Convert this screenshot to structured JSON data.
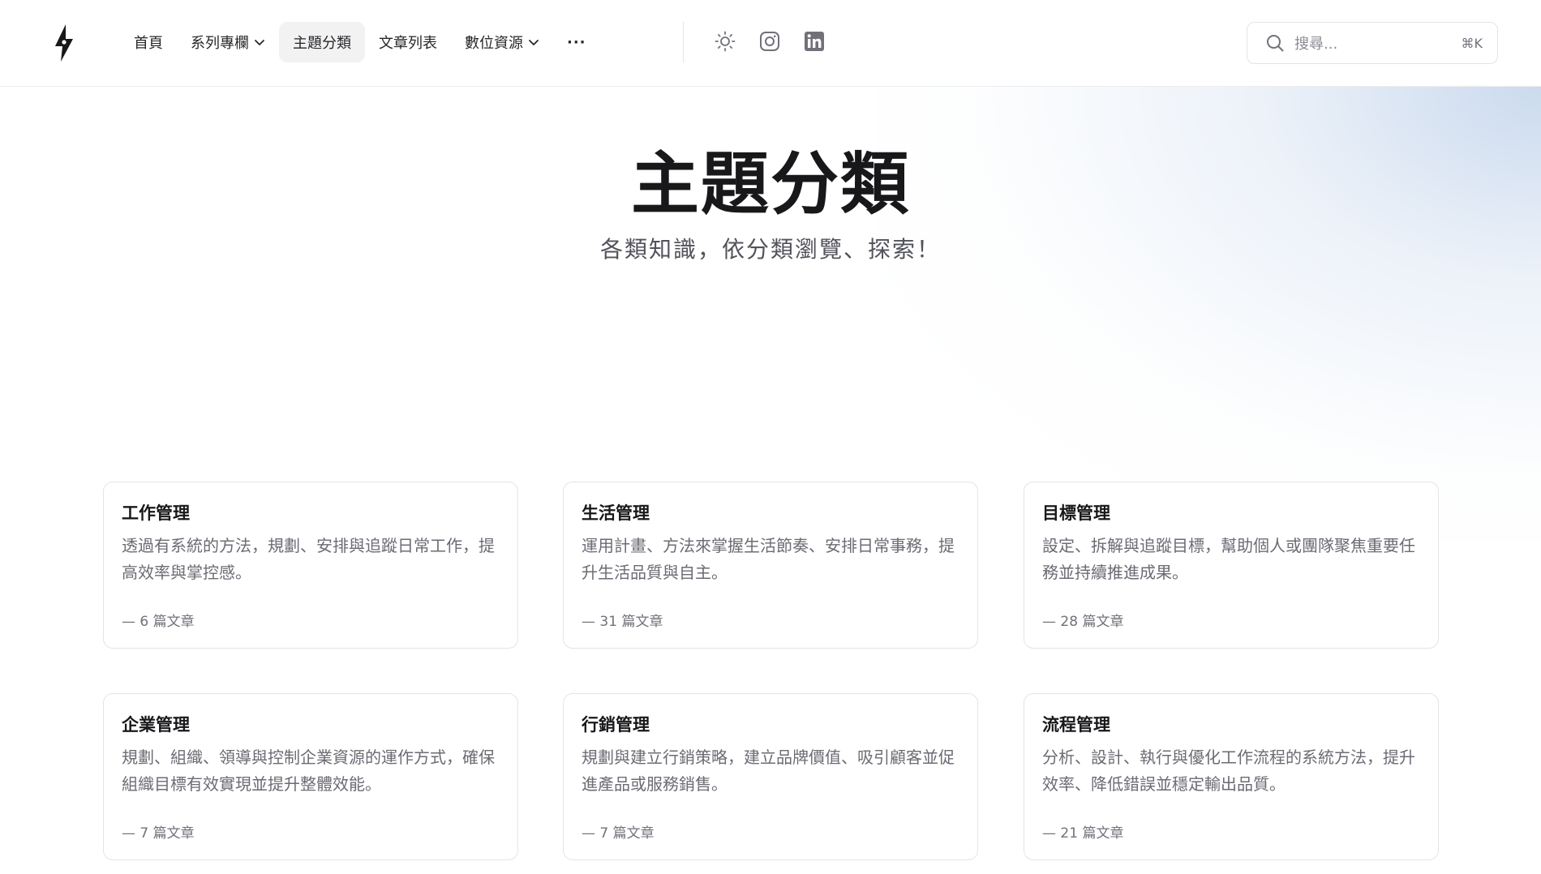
{
  "header": {
    "logo_icon": "lightning-bolt-logo",
    "nav": [
      {
        "label": "首頁",
        "dropdown": false,
        "active": false
      },
      {
        "label": "系列專欄",
        "dropdown": true,
        "active": false
      },
      {
        "label": "主題分類",
        "dropdown": false,
        "active": true
      },
      {
        "label": "文章列表",
        "dropdown": false,
        "active": false
      },
      {
        "label": "數位資源",
        "dropdown": true,
        "active": false
      },
      {
        "label": "···",
        "dropdown": false,
        "active": false
      }
    ],
    "icons": [
      "sun-icon",
      "instagram-icon",
      "linkedin-icon"
    ],
    "search": {
      "placeholder": "搜尋...",
      "shortcut": "⌘K"
    }
  },
  "hero": {
    "title": "主題分類",
    "subtitle": "各類知識，依分類瀏覽、探索！"
  },
  "categories": [
    {
      "title": "工作管理",
      "description": "透過有系統的方法，規劃、安排與追蹤日常工作，提高效率與掌控感。",
      "count": "— 6 篇文章"
    },
    {
      "title": "生活管理",
      "description": "運用計畫、方法來掌握生活節奏、安排日常事務，提升生活品質與自主。",
      "count": "— 31 篇文章"
    },
    {
      "title": "目標管理",
      "description": "設定、拆解與追蹤目標，幫助個人或團隊聚焦重要任務並持續推進成果。",
      "count": "— 28 篇文章"
    },
    {
      "title": "企業管理",
      "description": "規劃、組織、領導與控制企業資源的運作方式，確保組織目標有效實現並提升整體效能。",
      "count": "— 7 篇文章"
    },
    {
      "title": "行銷管理",
      "description": "規劃與建立行銷策略，建立品牌價值、吸引顧客並促進產品或服務銷售。",
      "count": "— 7 篇文章"
    },
    {
      "title": "流程管理",
      "description": "分析、設計、執行與優化工作流程的系統方法，提升效率、降低錯誤並穩定輸出品質。",
      "count": "— 21 篇文章"
    }
  ],
  "colors": {
    "text": "#18181b",
    "muted": "#6b6b74",
    "border": "#e4e4e7",
    "active_bg": "#f2f2f3",
    "glow": "#bacee8"
  }
}
